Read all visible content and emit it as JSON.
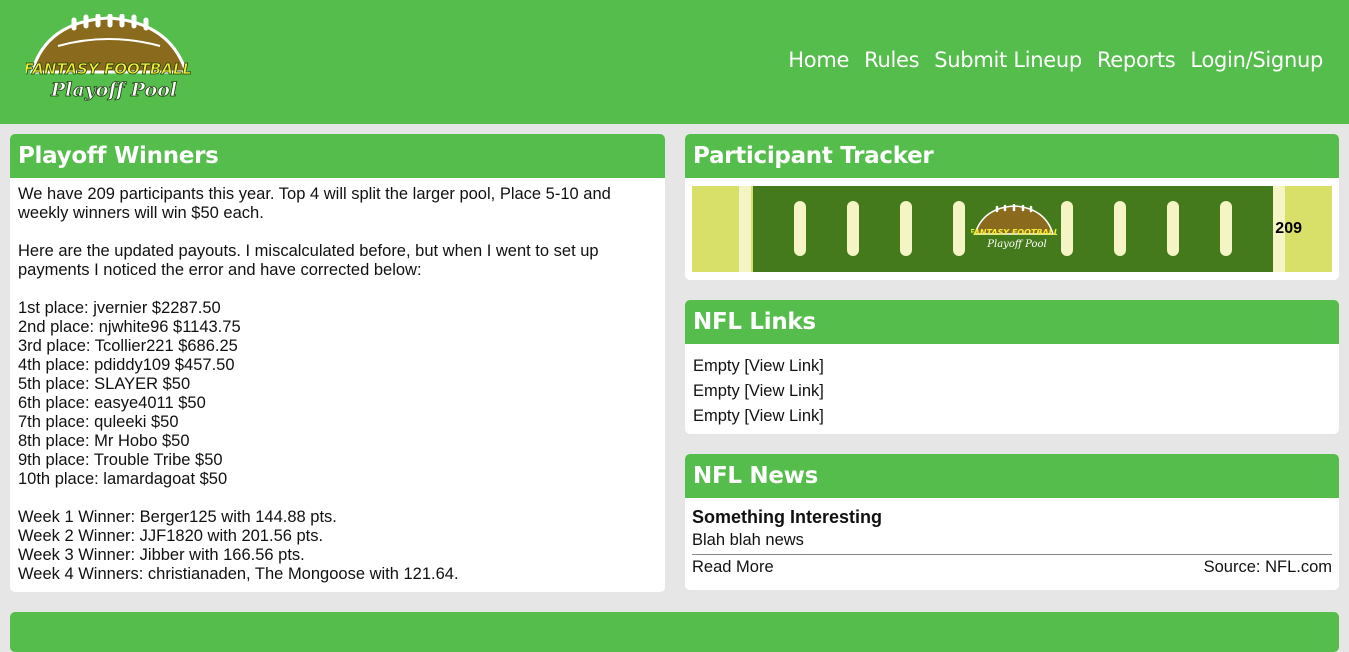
{
  "header": {
    "logo_text_top": "FANTASY FOOTBALL",
    "logo_text_bottom": "Playoff Pool",
    "nav": [
      "Home",
      "Rules",
      "Submit Lineup",
      "Reports",
      "Login/Signup"
    ]
  },
  "winners": {
    "title": "Playoff Winners",
    "intro": "We have 209 participants this year. Top 4 will split the larger pool, Place 5-10 and weekly winners will win $50 each.",
    "update": "Here are the updated payouts. I miscalculated before, but when I went to set up payments I noticed the error and have corrected below:",
    "places": [
      "1st place: jvernier $2287.50",
      "2nd place: njwhite96 $1143.75",
      "3rd place: Tcollier221 $686.25",
      "4th place: pdiddy109 $457.50",
      "5th place: SLAYER $50",
      "6th place: easye4011 $50",
      "7th place: quleeki $50",
      "8th place: Mr Hobo $50",
      "9th place: Trouble Tribe $50",
      "10th place: lamardagoat $50"
    ],
    "weeks": [
      "Week 1 Winner: Berger125 with 144.88 pts.",
      "Week 2 Winner: JJF1820 with 201.56 pts.",
      "Week 3 Winner: Jibber with 166.56 pts.",
      "Week 4 Winners: christianaden, The Mongoose with 121.64."
    ]
  },
  "tracker": {
    "title": "Participant Tracker",
    "count": "209",
    "logo_text_top": "FANTASY FOOTBALL",
    "logo_text_bottom": "Playoff Pool"
  },
  "links": {
    "title": "NFL Links",
    "items": [
      "Empty [View Link]",
      "Empty [View Link]",
      "Empty [View Link]"
    ]
  },
  "news": {
    "title": "NFL News",
    "headline": "Something Interesting",
    "text": "Blah blah news",
    "read_more": "Read More",
    "source": "Source: NFL.com"
  },
  "colors": {
    "brand_green": "#55bd4b",
    "field_green": "#447a1b",
    "endzone": "#d9e06a"
  }
}
